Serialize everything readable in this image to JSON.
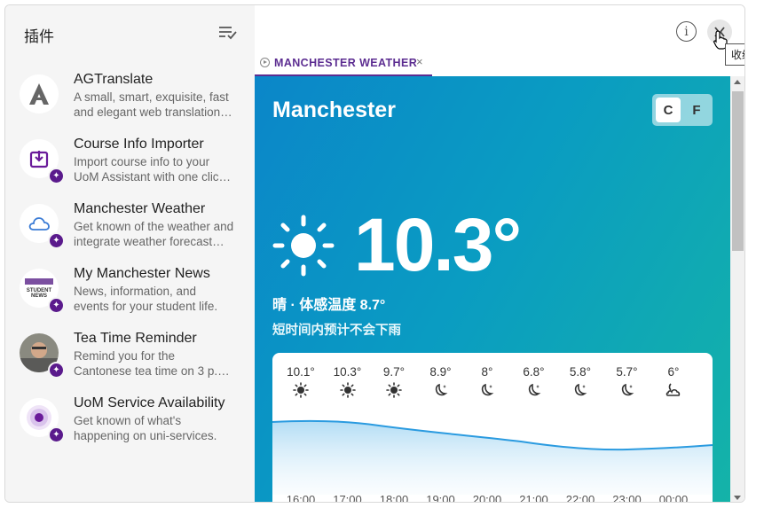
{
  "sidebar": {
    "title": "插件",
    "plugins": [
      {
        "name": "AGTranslate",
        "desc1": "A small, smart, exquisite, fast",
        "desc2": "and elegant web translation…",
        "icon": "letter-a-icon",
        "badge": false
      },
      {
        "name": "Course Info Importer",
        "desc1": "Import course info to your",
        "desc2": "UoM Assistant with one clic…",
        "icon": "download-box-icon",
        "badge": true
      },
      {
        "name": "Manchester Weather",
        "desc1": "Get known of the weather and",
        "desc2": "integrate weather forecast…",
        "icon": "cloud-icon",
        "badge": true
      },
      {
        "name": "My Manchester News",
        "desc1": "News, information, and",
        "desc2": "events for your student life.",
        "icon": "news-icon",
        "badge": true
      },
      {
        "name": "Tea Time Reminder",
        "desc1": "Remind you for the",
        "desc2": "Cantonese tea time on 3 p.…",
        "icon": "photo-avatar-icon",
        "badge": true
      },
      {
        "name": "UoM Service Availability",
        "desc1": "Get known of what's",
        "desc2": "happening on uni-services.",
        "icon": "status-dot-icon",
        "badge": true
      }
    ]
  },
  "header": {
    "info_icon": "ⓘ",
    "tooltip": "收缩"
  },
  "tab": {
    "label": "MANCHESTER WEATHER",
    "close": "×"
  },
  "weather": {
    "city": "Manchester",
    "unit_c": "C",
    "unit_f": "F",
    "temperature": "10.3°",
    "condition": "晴 · 体感温度 8.7°",
    "note": "短时间内预计不会下雨",
    "hourly": [
      {
        "temp": "10.1°",
        "icon": "sun",
        "time": "16:00"
      },
      {
        "temp": "10.3°",
        "icon": "sun",
        "time": "17:00"
      },
      {
        "temp": "9.7°",
        "icon": "sun",
        "time": "18:00"
      },
      {
        "temp": "8.9°",
        "icon": "moon-star",
        "time": "19:00"
      },
      {
        "temp": "8°",
        "icon": "moon-star",
        "time": "20:00"
      },
      {
        "temp": "6.8°",
        "icon": "moon-star",
        "time": "21:00"
      },
      {
        "temp": "5.8°",
        "icon": "moon-star",
        "time": "22:00"
      },
      {
        "temp": "5.7°",
        "icon": "moon-star",
        "time": "23:00"
      },
      {
        "temp": "6°",
        "icon": "moon-cloud",
        "time": "00:00"
      }
    ]
  },
  "colors": {
    "accent": "#5c2d91",
    "weather_gradient_start": "#0b86c9",
    "weather_gradient_end": "#14b3a8"
  }
}
